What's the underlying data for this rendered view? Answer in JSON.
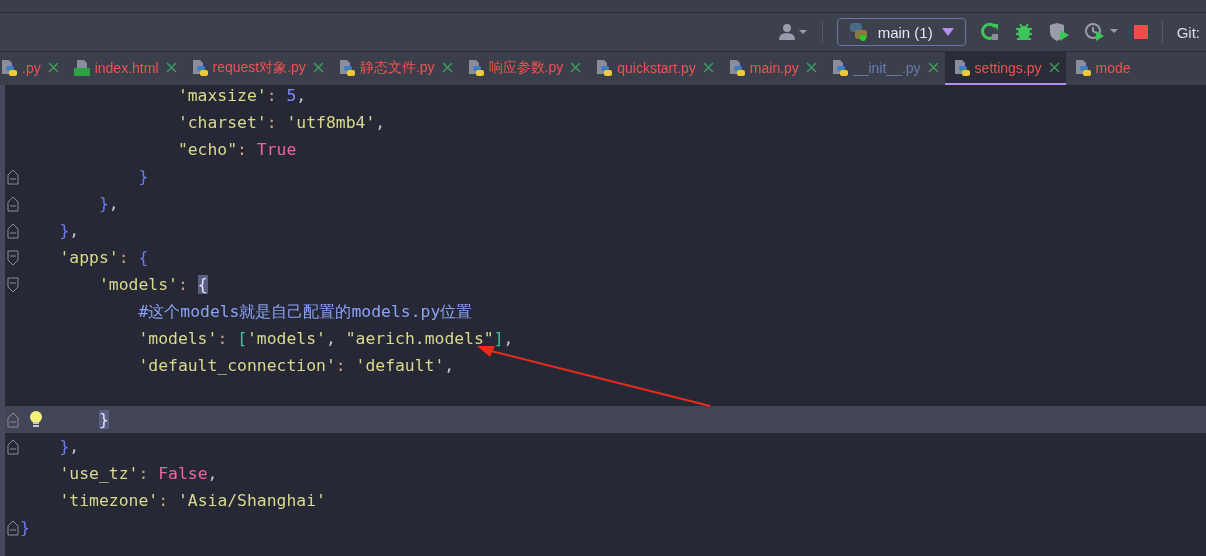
{
  "toolbar": {
    "run_config": "main (1)",
    "git_label": "Git:"
  },
  "tabs": [
    {
      "label": ".py",
      "kind": "python",
      "color": "#ef5350",
      "selected": false
    },
    {
      "label": "index.html",
      "kind": "html",
      "color": "#ef5350",
      "selected": false
    },
    {
      "label": "request对象.py",
      "kind": "python",
      "color": "#ef5350",
      "selected": false
    },
    {
      "label": "静态文件.py",
      "kind": "python",
      "color": "#ef5350",
      "selected": false
    },
    {
      "label": "响应参数.py",
      "kind": "python",
      "color": "#ef5350",
      "selected": false
    },
    {
      "label": "quickstart.py",
      "kind": "python",
      "color": "#ef5350",
      "selected": false
    },
    {
      "label": "main.py",
      "kind": "python",
      "color": "#ef5350",
      "selected": false
    },
    {
      "label": "__init__.py",
      "kind": "python",
      "color": "#6b7bb0",
      "selected": false
    },
    {
      "label": "settings.py",
      "kind": "python",
      "color": "#ef5350",
      "selected": true
    },
    {
      "label": "mode",
      "kind": "python",
      "color": "#ef5350",
      "selected": false
    }
  ],
  "code_lines": [
    {
      "kind": "code",
      "tokens": [
        {
          "text": "                'maxsize'",
          "kind": "str"
        },
        {
          "text": ": ",
          "kind": "punct"
        },
        {
          "text": "5",
          "kind": "num"
        },
        {
          "text": ",",
          "kind": "plain"
        }
      ]
    },
    {
      "kind": "code",
      "tokens": [
        {
          "text": "                'charset'",
          "kind": "str"
        },
        {
          "text": ": ",
          "kind": "punct"
        },
        {
          "text": "'utf8mb4'",
          "kind": "str"
        },
        {
          "text": ",",
          "kind": "plain"
        }
      ]
    },
    {
      "kind": "code",
      "tokens": [
        {
          "text": "                \"echo\"",
          "kind": "str"
        },
        {
          "text": ": ",
          "kind": "punct"
        },
        {
          "text": "True",
          "kind": "kw"
        }
      ]
    },
    {
      "kind": "fold_end",
      "tokens": [
        {
          "text": "            }",
          "kind": "brace"
        }
      ]
    },
    {
      "kind": "fold_end",
      "tokens": [
        {
          "text": "        }",
          "kind": "brace"
        },
        {
          "text": ",",
          "kind": "plain"
        }
      ]
    },
    {
      "kind": "fold_end",
      "tokens": [
        {
          "text": "    }",
          "kind": "brace"
        },
        {
          "text": ",",
          "kind": "plain"
        }
      ]
    },
    {
      "kind": "fold_start",
      "tokens": [
        {
          "text": "    'apps'",
          "kind": "str"
        },
        {
          "text": ": ",
          "kind": "punct"
        },
        {
          "text": "{",
          "kind": "brace"
        }
      ]
    },
    {
      "kind": "fold_start",
      "tokens": [
        {
          "text": "        'models'",
          "kind": "str"
        },
        {
          "text": ": ",
          "kind": "punct"
        },
        {
          "text": "{",
          "kind": "match"
        }
      ]
    },
    {
      "kind": "code",
      "tokens": [
        {
          "text": "            #这个models就是自己配置的models.py位置",
          "kind": "comment"
        }
      ]
    },
    {
      "kind": "code",
      "tokens": [
        {
          "text": "            'models'",
          "kind": "str"
        },
        {
          "text": ": ",
          "kind": "punct"
        },
        {
          "text": "[",
          "kind": "bracket"
        },
        {
          "text": "'models'",
          "kind": "str"
        },
        {
          "text": ", ",
          "kind": "plain"
        },
        {
          "text": "\"aerich.models\"",
          "kind": "str"
        },
        {
          "text": "]",
          "kind": "bracket"
        },
        {
          "text": ",",
          "kind": "plain"
        }
      ]
    },
    {
      "kind": "code",
      "tokens": [
        {
          "text": "            'default_connection'",
          "kind": "str"
        },
        {
          "text": ": ",
          "kind": "punct"
        },
        {
          "text": "'default'",
          "kind": "str"
        },
        {
          "text": ",",
          "kind": "plain"
        }
      ]
    },
    {
      "kind": "blank"
    },
    {
      "kind": "fold_end",
      "tokens": [
        {
          "text": "        }",
          "kind": "match"
        }
      ],
      "current": true,
      "bulb": true
    },
    {
      "kind": "fold_end",
      "tokens": [
        {
          "text": "    }",
          "kind": "brace"
        },
        {
          "text": ",",
          "kind": "plain"
        }
      ]
    },
    {
      "kind": "code",
      "tokens": [
        {
          "text": "    'use_tz'",
          "kind": "str"
        },
        {
          "text": ": ",
          "kind": "punct"
        },
        {
          "text": "False",
          "kind": "kw"
        },
        {
          "text": ",",
          "kind": "plain"
        }
      ]
    },
    {
      "kind": "code",
      "tokens": [
        {
          "text": "    'timezone'",
          "kind": "str"
        },
        {
          "text": ": ",
          "kind": "punct"
        },
        {
          "text": "'Asia/Shanghai'",
          "kind": "str"
        }
      ]
    },
    {
      "kind": "fold_end",
      "tokens": [
        {
          "text": "}",
          "kind": "brace"
        }
      ]
    }
  ]
}
